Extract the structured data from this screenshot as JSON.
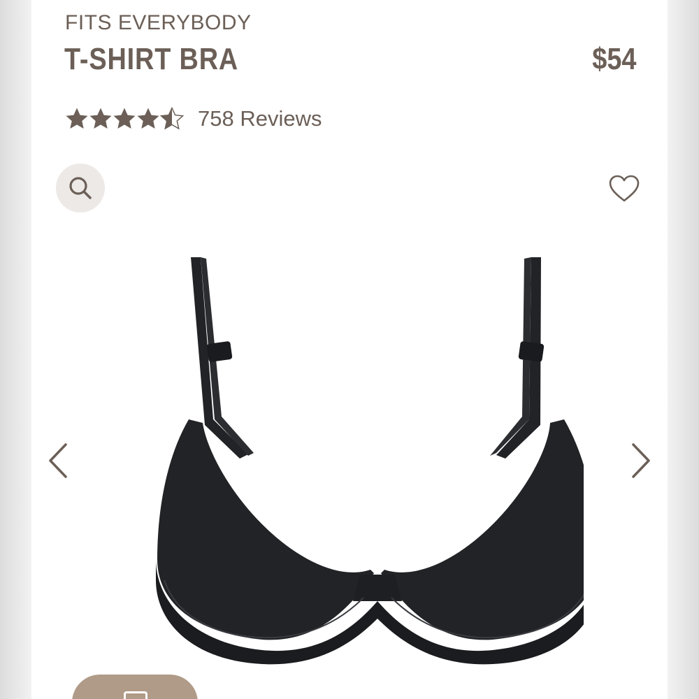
{
  "product": {
    "collection": "FITS EVERYBODY",
    "name": "T-SHIRT BRA",
    "price": "$54",
    "rating": 4.5,
    "rating_max": 5,
    "reviews_label": "758 Reviews"
  },
  "icons": {
    "zoom": "search-icon",
    "favorite": "heart-icon",
    "prev": "chevron-left-icon",
    "next": "chevron-right-icon",
    "star": "star-icon"
  },
  "colors": {
    "text": "#6b5f57",
    "star": "#6b5f57",
    "zoom_bg": "#ece9e7",
    "product": "#222326",
    "pill": "#b09b88"
  }
}
